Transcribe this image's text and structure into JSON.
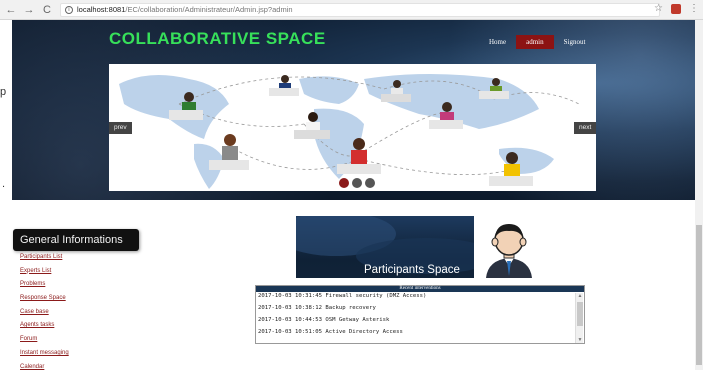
{
  "browser": {
    "url_host": "localhost:8081",
    "url_path": "/EC/collaboration/Administrateur/Admin.jsp?admin",
    "back": "←",
    "forward": "→",
    "reload": "C",
    "info": "i",
    "star": "☆",
    "menu": "⋮"
  },
  "header": {
    "title": "COLLABORATIVE SPACE",
    "nav": [
      {
        "label": "Home"
      },
      {
        "label": "admin"
      },
      {
        "label": "Signout"
      }
    ]
  },
  "slider": {
    "prev": "prev",
    "next": "next",
    "active_dot": 0
  },
  "page_edge": {
    "char1": "p",
    "char2": "."
  },
  "sidebar": {
    "title": "General Informations",
    "links": [
      {
        "label": "Participants List"
      },
      {
        "label": "Experts List"
      },
      {
        "label": "Problems"
      },
      {
        "label": "Response Space"
      },
      {
        "label": "Case base"
      },
      {
        "label": "Agents tasks"
      },
      {
        "label": "Forum"
      },
      {
        "label": "Instant messaging"
      },
      {
        "label": "Calendar"
      }
    ]
  },
  "participants_banner": {
    "title": "Participants Space"
  },
  "recent": {
    "title": "Recent interventions",
    "items": [
      "2017-10-03 10:31:45 Firewall security (DMZ Access)",
      "2017-10-03 10:38:12 Backup recovery",
      "2017-10-03 10:44:53 OSM Getway Asterisk",
      "2017-10-03 10:51:05 Active Directory Access"
    ]
  },
  "colors": {
    "title_green": "#37e05a",
    "active_red": "#8c1313",
    "link_red": "#8b1a1a"
  }
}
